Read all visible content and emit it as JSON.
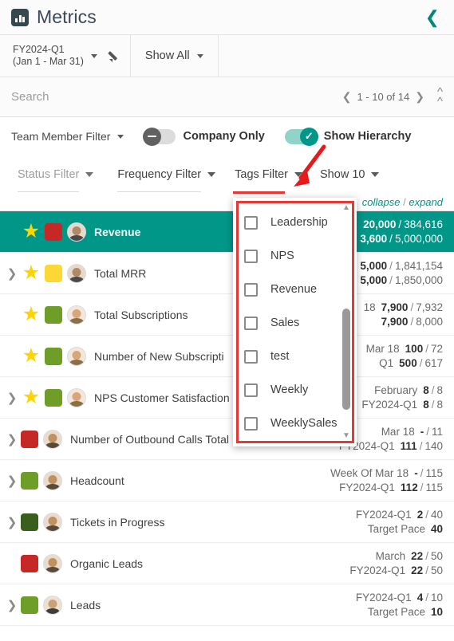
{
  "titlebar": {
    "app_icon": "bar-chart-icon",
    "title": "Metrics",
    "back_icon": "chevron-left-icon"
  },
  "periodbar": {
    "period_line1": "FY2024-Q1",
    "period_line2": "(Jan 1 - Mar 31)",
    "edit_icon": "pencil-icon",
    "show_all_label": "Show All"
  },
  "search": {
    "placeholder": "Search",
    "value": "",
    "prev_icon": "chevron-left-icon",
    "pagination": "1 - 10 of 14",
    "next_icon": "chevron-right-icon",
    "collapse_all_icon": "double-chevron-up-icon"
  },
  "toggles": {
    "team_member_filter": "Team Member Filter",
    "company_only": {
      "label": "Company Only",
      "on": false
    },
    "show_hierarchy": {
      "label": "Show Hierarchy",
      "on": true
    }
  },
  "filters": [
    {
      "label": "Status Filter",
      "muted": true,
      "underline": "gray"
    },
    {
      "label": "Frequency Filter",
      "muted": false,
      "underline": "gray"
    },
    {
      "label": "Tags Filter",
      "muted": false,
      "underline": "red",
      "open": true
    },
    {
      "label": "Show 10",
      "muted": false,
      "underline": "none"
    }
  ],
  "tags_dropdown": {
    "items": [
      {
        "label": "Leadership",
        "checked": false
      },
      {
        "label": "NPS",
        "checked": false
      },
      {
        "label": "Revenue",
        "checked": false
      },
      {
        "label": "Sales",
        "checked": false
      },
      {
        "label": "test",
        "checked": false
      },
      {
        "label": "Weekly",
        "checked": false
      },
      {
        "label": "WeeklySales",
        "checked": false
      }
    ],
    "scroll_up_icon": "triangle-up-icon",
    "scroll_down_icon": "triangle-down-icon"
  },
  "table": {
    "collapse_label": "collapse",
    "separator": "/",
    "expand_label": "expand",
    "rows": [
      {
        "name": "Revenue",
        "selected": true,
        "expandable": false,
        "starred": true,
        "status_color": "#c62828",
        "avatar": "m1",
        "values": [
          {
            "period": "",
            "actual": "20,000",
            "target": "384,616"
          },
          {
            "period": "",
            "actual": "3,600",
            "target": "5,000,000"
          }
        ]
      },
      {
        "name": "Total MRR",
        "selected": false,
        "expandable": true,
        "starred": true,
        "status_color": "#fdd835",
        "avatar": "m1",
        "values": [
          {
            "period": "",
            "actual": "5,000",
            "target": "1,841,154"
          },
          {
            "period": "",
            "actual": "5,000",
            "target": "1,850,000"
          }
        ]
      },
      {
        "name": "Total Subscriptions",
        "selected": false,
        "expandable": false,
        "starred": true,
        "status_color": "#6f9e28",
        "avatar": "f1",
        "values": [
          {
            "period": "18",
            "actual": "7,900",
            "target": "7,932"
          },
          {
            "period": "",
            "actual": "7,900",
            "target": "8,000"
          }
        ]
      },
      {
        "name": "Number of New Subscripti",
        "selected": false,
        "expandable": false,
        "starred": true,
        "status_color": "#6f9e28",
        "avatar": "f1",
        "values": [
          {
            "period": "Mar 18",
            "actual": "100",
            "target": "72"
          },
          {
            "period": "Q1",
            "actual": "500",
            "target": "617"
          }
        ]
      },
      {
        "name": "NPS Customer Satisfaction",
        "selected": false,
        "expandable": true,
        "starred": true,
        "status_color": "#6f9e28",
        "avatar": "f1",
        "values": [
          {
            "period": "February",
            "actual": "8",
            "target": "8"
          },
          {
            "period": "FY2024-Q1",
            "actual": "8",
            "target": "8"
          }
        ]
      },
      {
        "name": "Number of Outbound Calls Total",
        "selected": false,
        "expandable": true,
        "starred": false,
        "status_color": "#c62828",
        "avatar": "m2",
        "values": [
          {
            "period": "Mar 18",
            "actual": "-",
            "target": "11"
          },
          {
            "period": "FY2024-Q1",
            "actual": "111",
            "target": "140"
          }
        ]
      },
      {
        "name": "Headcount",
        "selected": false,
        "expandable": true,
        "starred": false,
        "status_color": "#6f9e28",
        "avatar": "m2",
        "values": [
          {
            "period": "Week Of Mar 18",
            "actual": "-",
            "target": "115"
          },
          {
            "period": "FY2024-Q1",
            "actual": "112",
            "target": "115"
          }
        ]
      },
      {
        "name": "Tickets in Progress",
        "selected": false,
        "expandable": true,
        "starred": false,
        "status_color": "#3b5e1e",
        "avatar": "m2",
        "values": [
          {
            "period": "FY2024-Q1",
            "actual": "2",
            "target": "40"
          },
          {
            "period": "Target Pace",
            "actual": "",
            "target": "40",
            "pace": true
          }
        ]
      },
      {
        "name": "Organic Leads",
        "selected": false,
        "expandable": false,
        "starred": false,
        "status_color": "#c62828",
        "avatar": "m2",
        "values": [
          {
            "period": "March",
            "actual": "22",
            "target": "50"
          },
          {
            "period": "FY2024-Q1",
            "actual": "22",
            "target": "50"
          }
        ]
      },
      {
        "name": "Leads",
        "selected": false,
        "expandable": true,
        "starred": false,
        "status_color": "#6f9e28",
        "avatar": "m3",
        "values": [
          {
            "period": "FY2024-Q1",
            "actual": "4",
            "target": "10"
          },
          {
            "period": "Target Pace",
            "actual": "",
            "target": "10",
            "pace": true
          }
        ]
      }
    ]
  },
  "annotation": {
    "arrow_color": "#e8191b",
    "highlight_color": "#e53935"
  }
}
